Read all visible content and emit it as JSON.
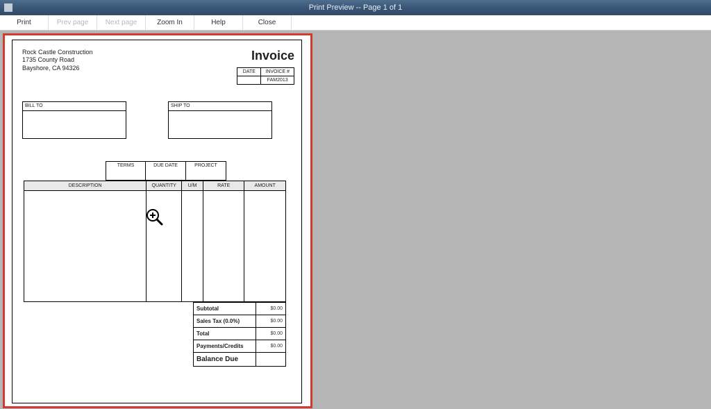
{
  "window": {
    "title": "Print Preview -- Page 1 of 1"
  },
  "toolbar": {
    "print": "Print",
    "prev": "Prev page",
    "next": "Next page",
    "zoom": "Zoom In",
    "help": "Help",
    "close": "Close"
  },
  "invoice": {
    "company": "Rock Castle Construction",
    "addr1": "1735 County Road",
    "addr2": "Bayshore, CA 94326",
    "title": "Invoice",
    "meta": {
      "date_h": "DATE",
      "num_h": "INVOICE #",
      "date_v": "",
      "num_v": "FAM2013"
    },
    "bill_to": "BILL TO",
    "ship_to": "SHIP TO",
    "terms_h": "TERMS",
    "duedate_h": "DUE DATE",
    "project_h": "PROJECT",
    "cols": {
      "desc": "DESCRIPTION",
      "qty": "QUANTITY",
      "um": "U/M",
      "rate": "RATE",
      "amount": "AMOUNT"
    },
    "totals": {
      "subtotal": "Subtotal",
      "subtotal_v": "$0.00",
      "tax": "Sales Tax  (0.0%)",
      "tax_v": "$0.00",
      "total": "Total",
      "total_v": "$0.00",
      "payments": "Payments/Credits",
      "payments_v": "$0.00",
      "balance": "Balance Due",
      "balance_v": ""
    }
  }
}
